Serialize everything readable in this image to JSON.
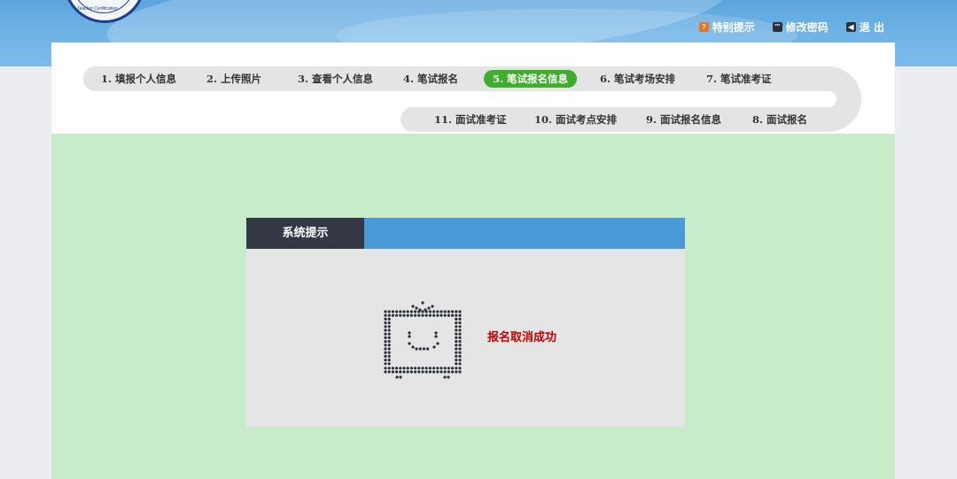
{
  "header": {
    "links": [
      {
        "icon": "notice-icon",
        "label": "特别提示"
      },
      {
        "icon": "password-icon",
        "label": "修改密码"
      },
      {
        "icon": "logout-icon",
        "label": "退 出"
      }
    ],
    "logo_text": "Teacher Certification"
  },
  "steps_row1": [
    {
      "label": "1. 填报个人信息"
    },
    {
      "label": "2. 上传照片"
    },
    {
      "label": "3. 查看个人信息"
    },
    {
      "label": "4. 笔试报名"
    },
    {
      "label": "5. 笔试报名信息",
      "active": true
    },
    {
      "label": "6. 笔试考场安排"
    },
    {
      "label": "7. 笔试准考证"
    }
  ],
  "steps_row2": [
    {
      "label": "11. 面试准考证"
    },
    {
      "label": "10. 面试考点安排"
    },
    {
      "label": "9. 面试报名信息"
    },
    {
      "label": "8. 面试报名"
    }
  ],
  "dialog": {
    "title": "系统提示",
    "message": "报名取消成功",
    "icon": "tv-smile-icon"
  },
  "colors": {
    "header": "#6fb3e6",
    "active_step": "#3fae2a",
    "content_bg": "#c8ecca",
    "dialog_head": "#4a9ada",
    "dialog_title_bg": "#343845",
    "message": "#c00000"
  }
}
